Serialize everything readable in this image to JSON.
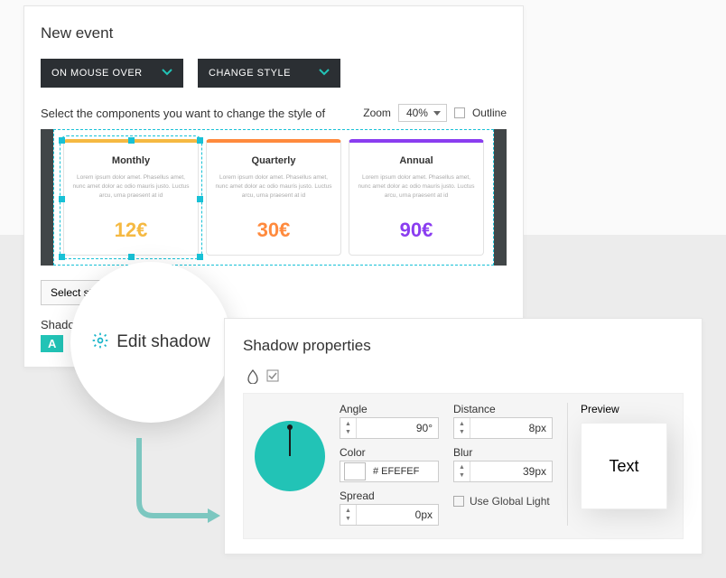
{
  "header": {
    "title": "New event"
  },
  "selects": {
    "trigger": "ON MOUSE OVER",
    "action": "CHANGE STYLE"
  },
  "instruction": "Select the components you want to change the style of",
  "zoom": {
    "label": "Zoom",
    "value": "40% "
  },
  "outline": {
    "label": "Outline"
  },
  "cards": [
    {
      "title": "Monthly",
      "body": "Lorem ipsum dolor amet. Phasellus amet, nunc amet dolor ac odio mauris justo. Luctus arcu, urna praesent at id",
      "price": "12€",
      "accent": "#f5b942",
      "priceColor": "#f5b942"
    },
    {
      "title": "Quarterly",
      "body": "Lorem ipsum dolor amet. Phasellus amet, nunc amet dolor ac odio mauris justo. Luctus arcu, urna praesent at id",
      "price": "30€",
      "accent": "#ff8a3d",
      "priceColor": "#ff8a3d"
    },
    {
      "title": "Annual",
      "body": "Lorem ipsum dolor amet. Phasellus amet, nunc amet dolor ac odio mauris justo. Luctus arcu, urna praesent at id",
      "price": "90€",
      "accent": "#8a3df0",
      "priceColor": "#8a3df0"
    }
  ],
  "selectStyle": {
    "label": "Select style"
  },
  "shadowLabel": "Shadow",
  "shadowBadge": "A",
  "callout": {
    "label": "Edit shadow"
  },
  "shadowPanel": {
    "title": "Shadow properties",
    "angle": {
      "label": "Angle",
      "value": "90°"
    },
    "distance": {
      "label": "Distance",
      "value": "8px"
    },
    "color": {
      "label": "Color",
      "value": "# EFEFEF"
    },
    "blur": {
      "label": "Blur",
      "value": "39px"
    },
    "spread": {
      "label": "Spread",
      "value": "0px"
    },
    "useGlobal": {
      "label": "Use Global Light"
    },
    "preview": {
      "label": "Preview",
      "text": "Text"
    }
  }
}
